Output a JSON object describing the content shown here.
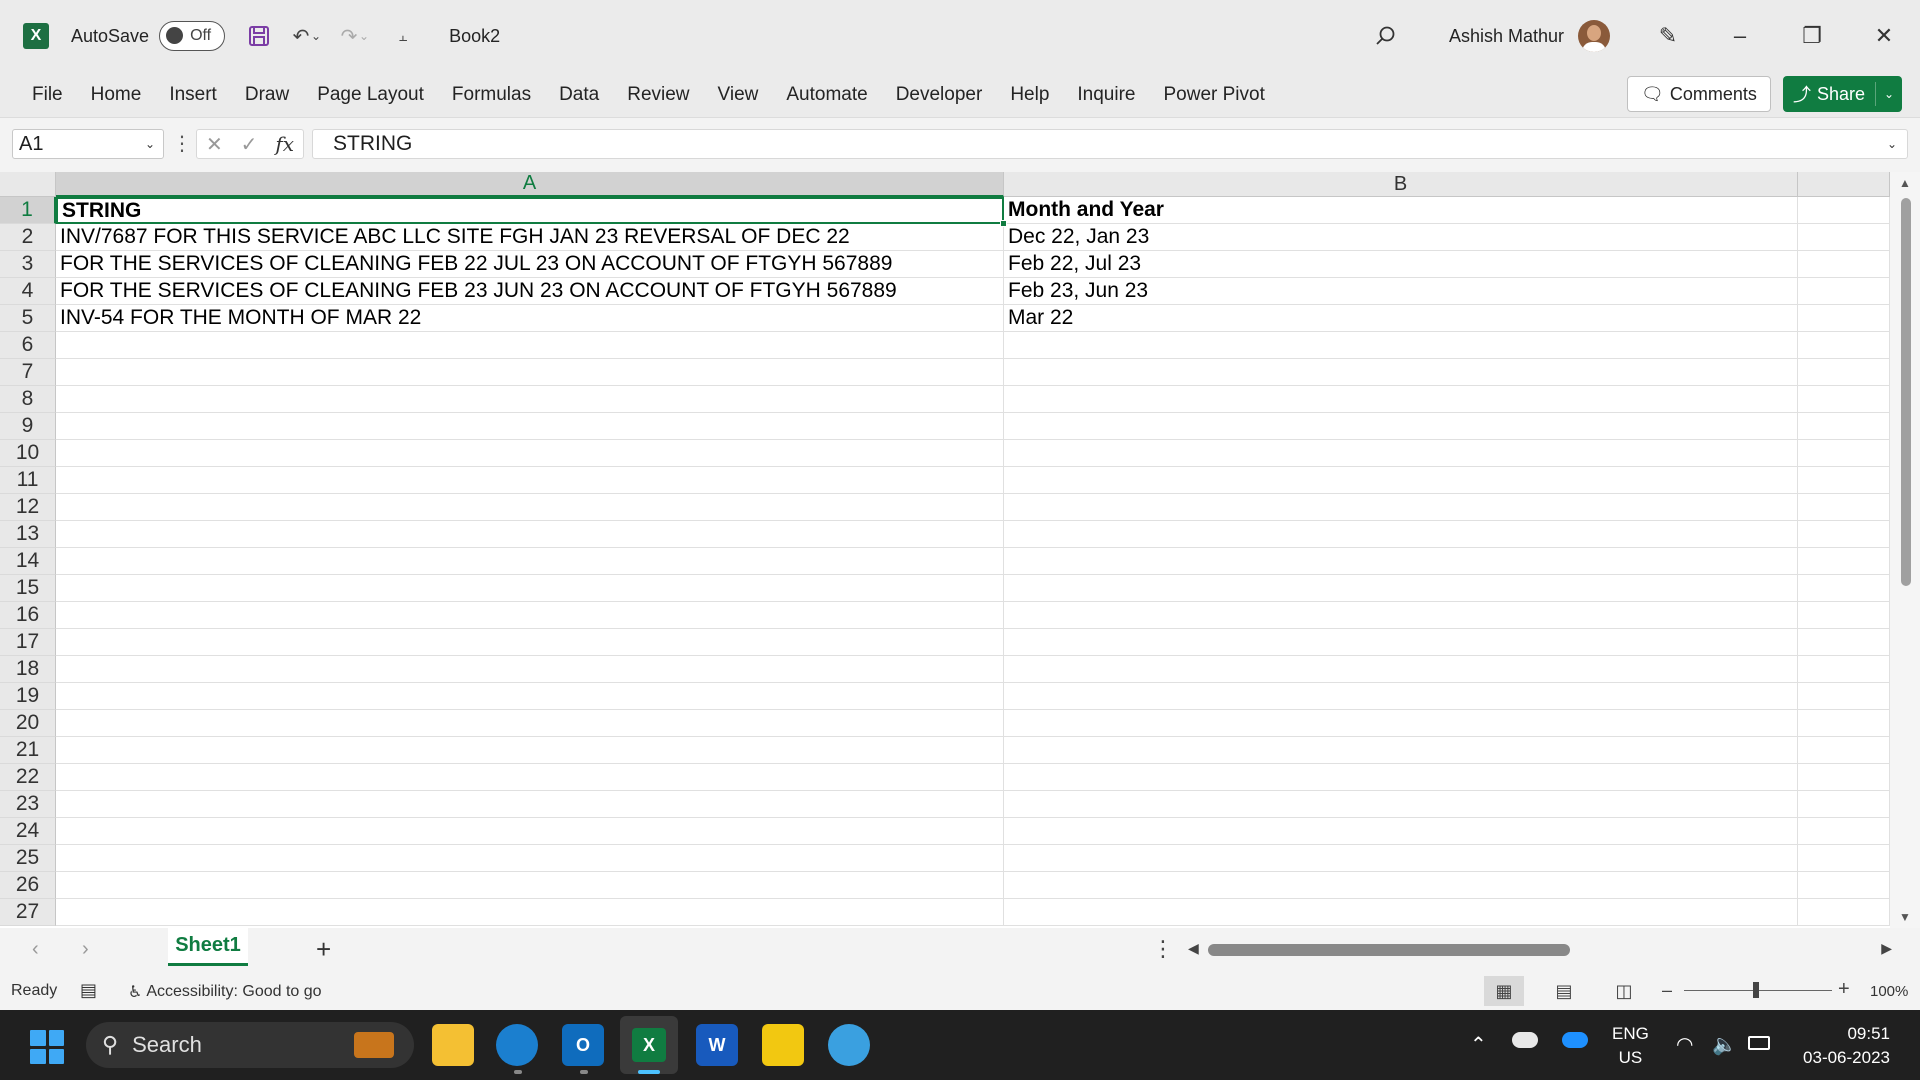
{
  "titlebar": {
    "autosave_label": "AutoSave",
    "autosave_state": "Off",
    "doc_title": "Book2",
    "user_name": "Ashish Mathur"
  },
  "ribbon": {
    "tabs": [
      "File",
      "Home",
      "Insert",
      "Draw",
      "Page Layout",
      "Formulas",
      "Data",
      "Review",
      "View",
      "Automate",
      "Developer",
      "Help",
      "Inquire",
      "Power Pivot"
    ],
    "comments_label": "Comments",
    "share_label": "Share"
  },
  "formula_bar": {
    "name_box": "A1",
    "formula": "STRING",
    "fx": "fx"
  },
  "grid": {
    "columns": [
      "A",
      "B"
    ],
    "rows": [
      "1",
      "2",
      "3",
      "4",
      "5",
      "6",
      "7",
      "8",
      "9",
      "10",
      "11",
      "12",
      "13",
      "14",
      "15",
      "16",
      "17",
      "18",
      "19",
      "20",
      "21",
      "22",
      "23",
      "24",
      "25",
      "26",
      "27"
    ],
    "cells": [
      [
        "STRING",
        "Month and Year"
      ],
      [
        "INV/7687 FOR THIS SERVICE ABC LLC SITE FGH JAN 23 REVERSAL OF DEC 22",
        "Dec 22, Jan 23"
      ],
      [
        "FOR THE SERVICES OF CLEANING FEB 22 JUL 23 ON ACCOUNT OF FTGYH 567889",
        "Feb 22, Jul 23"
      ],
      [
        "FOR THE SERVICES OF CLEANING FEB 23 JUN 23 ON ACCOUNT OF FTGYH 567889",
        "Feb 23, Jun 23"
      ],
      [
        "INV-54 FOR THE MONTH OF MAR 22",
        "Mar 22"
      ]
    ],
    "active_cell": "A1"
  },
  "sheets": {
    "tabs": [
      "Sheet1"
    ],
    "active": "Sheet1"
  },
  "status": {
    "ready": "Ready",
    "accessibility": "Accessibility: Good to go",
    "zoom": "100%"
  },
  "taskbar": {
    "search_placeholder": "Search",
    "lang_line1": "ENG",
    "lang_line2": "US",
    "time": "09:51",
    "date": "03-06-2023"
  },
  "colors": {
    "excel_green": "#107c41",
    "taskbar_bg": "#202020"
  }
}
